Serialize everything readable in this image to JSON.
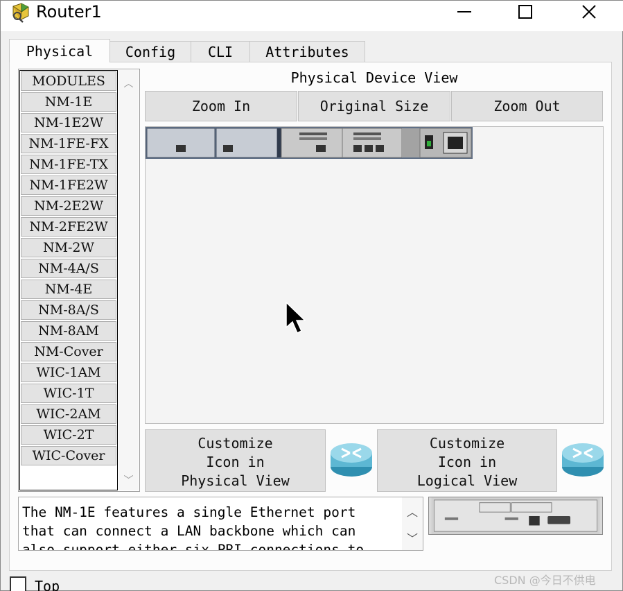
{
  "window": {
    "title": "Router1"
  },
  "title_controls": {
    "minimize": "—",
    "maximize": "☐",
    "close": "✕"
  },
  "tabs": [
    {
      "label": "Physical",
      "active": true
    },
    {
      "label": "Config",
      "active": false
    },
    {
      "label": "CLI",
      "active": false
    },
    {
      "label": "Attributes",
      "active": false
    }
  ],
  "modules": {
    "items": [
      "MODULES",
      "NM-1E",
      "NM-1E2W",
      "NM-1FE-FX",
      "NM-1FE-TX",
      "NM-1FE2W",
      "NM-2E2W",
      "NM-2FE2W",
      "NM-2W",
      "NM-4A/S",
      "NM-4E",
      "NM-8A/S",
      "NM-8AM",
      "NM-Cover",
      "WIC-1AM",
      "WIC-1T",
      "WIC-2AM",
      "WIC-2T",
      "WIC-Cover"
    ]
  },
  "physical_view": {
    "label": "Physical Device View",
    "zoom_in": "Zoom In",
    "original_size": "Original Size",
    "zoom_out": "Zoom Out"
  },
  "customize": {
    "physical": [
      "Customize",
      "Icon in",
      "Physical View"
    ],
    "logical": [
      "Customize",
      "Icon in",
      "Logical View"
    ]
  },
  "description": {
    "text": "The NM-1E features a single Ethernet port\nthat can connect a LAN backbone which can\nalso support either six PRI connections to"
  },
  "footer": {
    "top_checkbox_label": "Top",
    "top_checked": false
  },
  "watermark": "CSDN @今日不供电",
  "colors": {
    "title_bg": "#ffffff",
    "panel_bg": "#fcfcfc",
    "button_bg": "#e1e1e1",
    "window_bg": "#f0f0f0"
  }
}
